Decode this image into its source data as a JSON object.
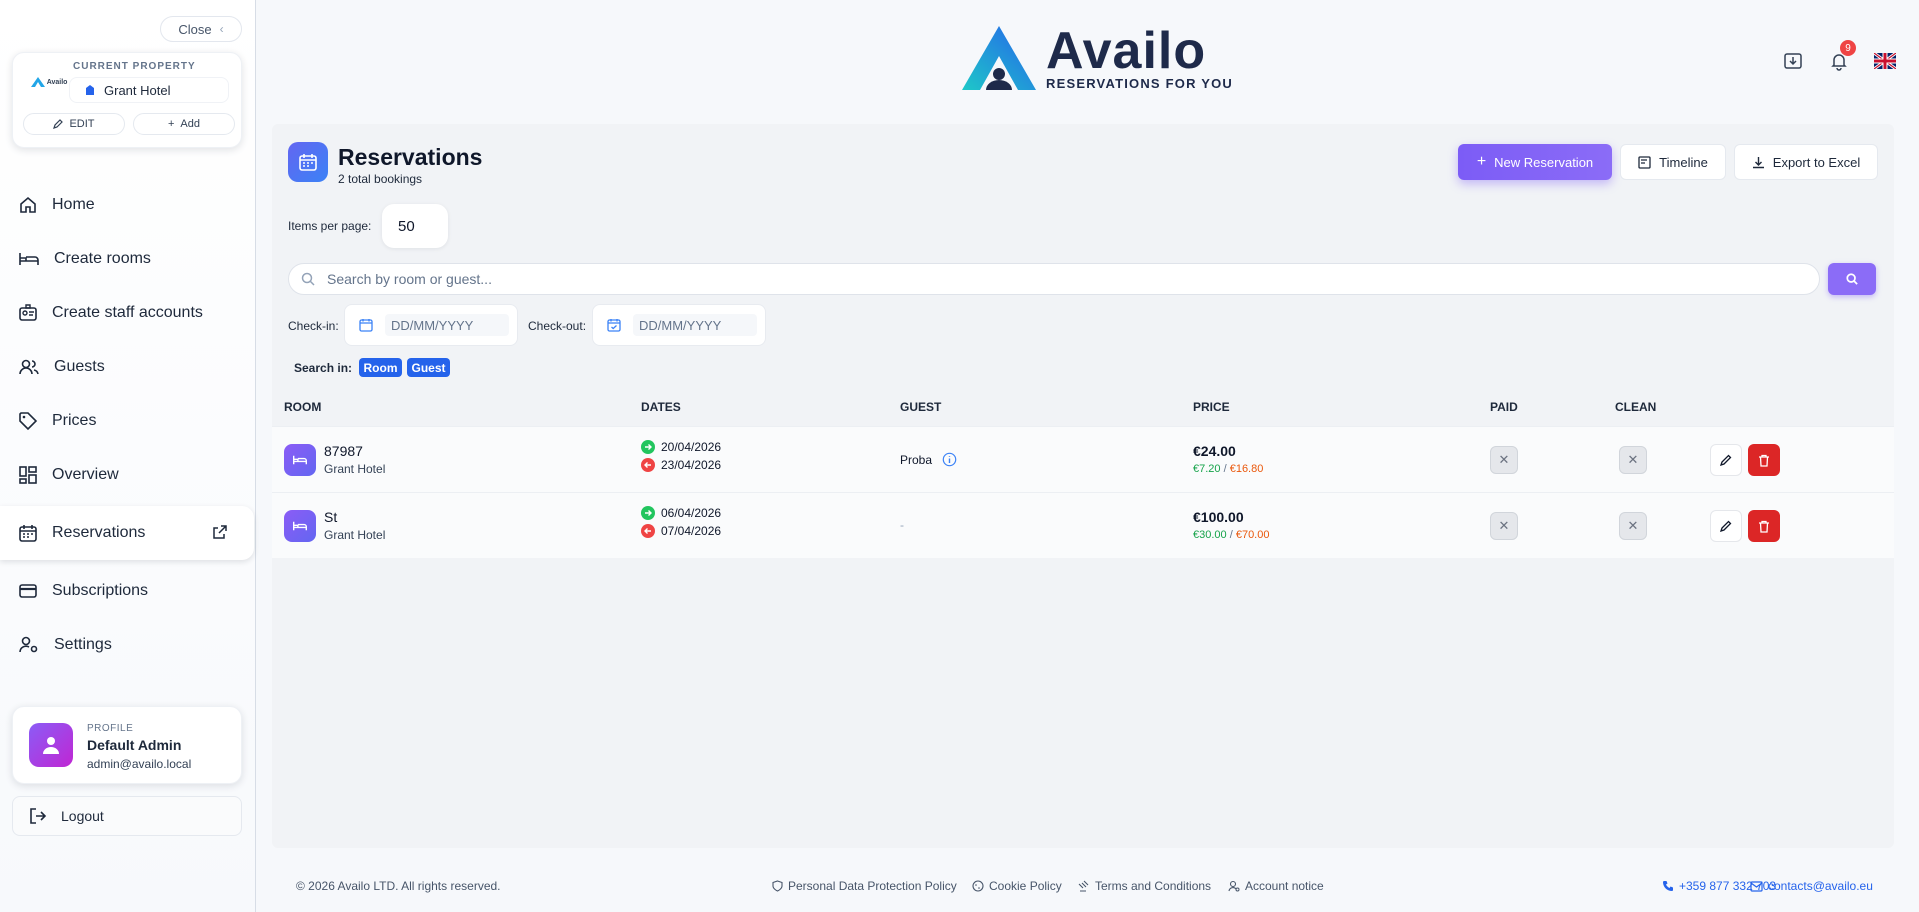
{
  "sidebar": {
    "close_label": "Close",
    "property": {
      "logo_text": "Availo",
      "label": "CURRENT PROPERTY",
      "name": "Grant Hotel",
      "edit_label": "EDIT",
      "add_label": "Add"
    },
    "items": [
      {
        "label": "Home",
        "icon": "home-icon"
      },
      {
        "label": "Create rooms",
        "icon": "bed-icon"
      },
      {
        "label": "Create staff accounts",
        "icon": "id-badge-icon"
      },
      {
        "label": "Guests",
        "icon": "users-icon"
      },
      {
        "label": "Prices",
        "icon": "tag-icon"
      },
      {
        "label": "Overview",
        "icon": "dashboard-icon"
      },
      {
        "label": "Reservations",
        "icon": "calendar-icon",
        "active": true
      },
      {
        "label": "Subscriptions",
        "icon": "credit-card-icon"
      },
      {
        "label": "Settings",
        "icon": "user-gear-icon"
      }
    ],
    "profile": {
      "label": "PROFILE",
      "name": "Default Admin",
      "email": "admin@availo.local"
    },
    "logout_label": "Logout"
  },
  "header": {
    "brand": "Availo",
    "tagline": "RESERVATIONS FOR YOU",
    "notification_count": "9",
    "language": "EN"
  },
  "page": {
    "title": "Reservations",
    "subtitle": "2 total bookings",
    "new_button": "New Reservation",
    "timeline_button": "Timeline",
    "export_button": "Export to Excel",
    "items_per_page_label": "Items per page:",
    "items_per_page_value": "50",
    "search_placeholder": "Search by room or guest...",
    "checkin_label": "Check-in:",
    "checkout_label": "Check-out:",
    "date_placeholder": "DD/MM/YYYY",
    "search_in_label": "Search in:",
    "search_in_chips": [
      "Room",
      "Guest"
    ]
  },
  "table": {
    "columns": [
      "ROOM",
      "DATES",
      "GUEST",
      "PRICE",
      "PAID",
      "CLEAN"
    ],
    "rows": [
      {
        "room": "87987",
        "property": "Grant Hotel",
        "checkin": "20/04/2026",
        "checkout": "23/04/2026",
        "guest": "Proba",
        "price": "€24.00",
        "split_a": "€7.20",
        "split_sep": " / ",
        "split_b": "€16.80"
      },
      {
        "room": "St",
        "property": "Grant Hotel",
        "checkin": "06/04/2026",
        "checkout": "07/04/2026",
        "guest": "-",
        "price": "€100.00",
        "split_a": "€30.00",
        "split_sep": " / ",
        "split_b": "€70.00"
      }
    ]
  },
  "footer": {
    "copyright": "© 2026 Availo LTD. All rights reserved.",
    "links": [
      "Personal Data Protection Policy",
      "Cookie Policy",
      "Terms and Conditions",
      "Account notice"
    ],
    "phone": "+359 877 332 703",
    "email": "contacts@availo.eu"
  },
  "colors": {
    "accent": "#8b6cf7",
    "danger": "#dc2626",
    "checkin_green": "#22c55e",
    "checkout_red": "#ef4444",
    "chip_blue": "#2563eb"
  }
}
